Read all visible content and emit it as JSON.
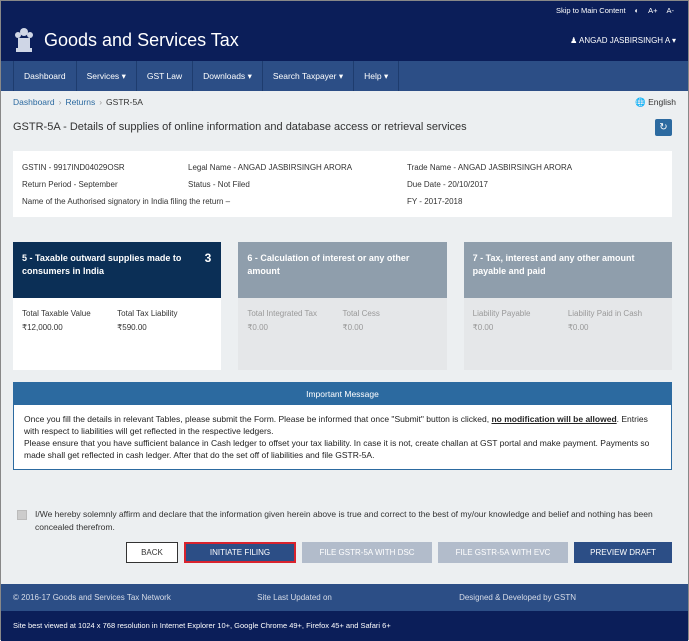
{
  "topbar": {
    "skip": "Skip to Main Content",
    "contrast": "◐",
    "font_inc": "A+",
    "font_dec": "A-"
  },
  "header": {
    "title": "Goods and Services Tax",
    "user": "ANGAD JASBIRSINGH A"
  },
  "nav": [
    "Dashboard",
    "Services",
    "GST Law",
    "Downloads",
    "Search Taxpayer",
    "Help"
  ],
  "breadcrumb": {
    "dashboard": "Dashboard",
    "returns": "Returns",
    "current": "GSTR-5A",
    "lang": "English"
  },
  "page": {
    "title": "GSTR-5A - Details of supplies of online information and database access or retrieval services"
  },
  "info": {
    "gstin": "GSTIN - 9917IND04029OSR",
    "legal": "Legal Name - ANGAD JASBIRSINGH ARORA",
    "trade": "Trade Name - ANGAD JASBIRSINGH ARORA",
    "period": "Return Period - September",
    "status": "Status - Not Filed",
    "due": "Due Date - 20/10/2017",
    "signatory": "Name of the Authorised signatory in India filing the return –",
    "fy": "FY - 2017-2018"
  },
  "tiles": [
    {
      "title": "5 - Taxable outward supplies made to consumers in India",
      "count": "3",
      "l1": "Total Taxable Value",
      "v1": "₹12,000.00",
      "l2": "Total Tax Liability",
      "v2": "₹590.00"
    },
    {
      "title": "6 - Calculation of interest or any other amount",
      "l1": "Total Integrated Tax",
      "v1": "₹0.00",
      "l2": "Total Cess",
      "v2": "₹0.00"
    },
    {
      "title": "7 - Tax, interest and any other amount payable and paid",
      "l1": "Liability Payable",
      "v1": "₹0.00",
      "l2": "Liability Paid in Cash",
      "v2": "₹0.00"
    }
  ],
  "message": {
    "head": "Important Message",
    "p1a": "Once you fill the details in relevant Tables, please submit the Form. Please be informed that once \"Submit\" button is clicked, ",
    "p1b": "no modification will be allowed",
    "p1c": ". Entries with respect to liabilities will get reflected in the respective ledgers.",
    "p2": "Please ensure that you have sufficient balance in Cash ledger to offset your tax liability. In case it is not, create challan at GST portal and make payment. Payments so made shall get reflected in cash ledger. After that do the set off of liabilities and file GSTR-5A."
  },
  "declaration": "I/We hereby solemnly affirm and declare that the information given herein above is true and correct to the best of my/our knowledge and belief and nothing has been concealed therefrom.",
  "buttons": {
    "back": "BACK",
    "initiate": "INITIATE FILING",
    "dsc": "FILE GSTR-5A WITH DSC",
    "evc": "FILE GSTR-5A WITH EVC",
    "preview": "PREVIEW DRAFT"
  },
  "footer": {
    "copy": "© 2016-17 Goods and Services Tax Network",
    "updated": "Site Last Updated on",
    "designed": "Designed & Developed by GSTN",
    "best": "Site best viewed at 1024 x 768 resolution in Internet Explorer 10+, Google Chrome 49+, Firefox 45+ and Safari 6+"
  }
}
